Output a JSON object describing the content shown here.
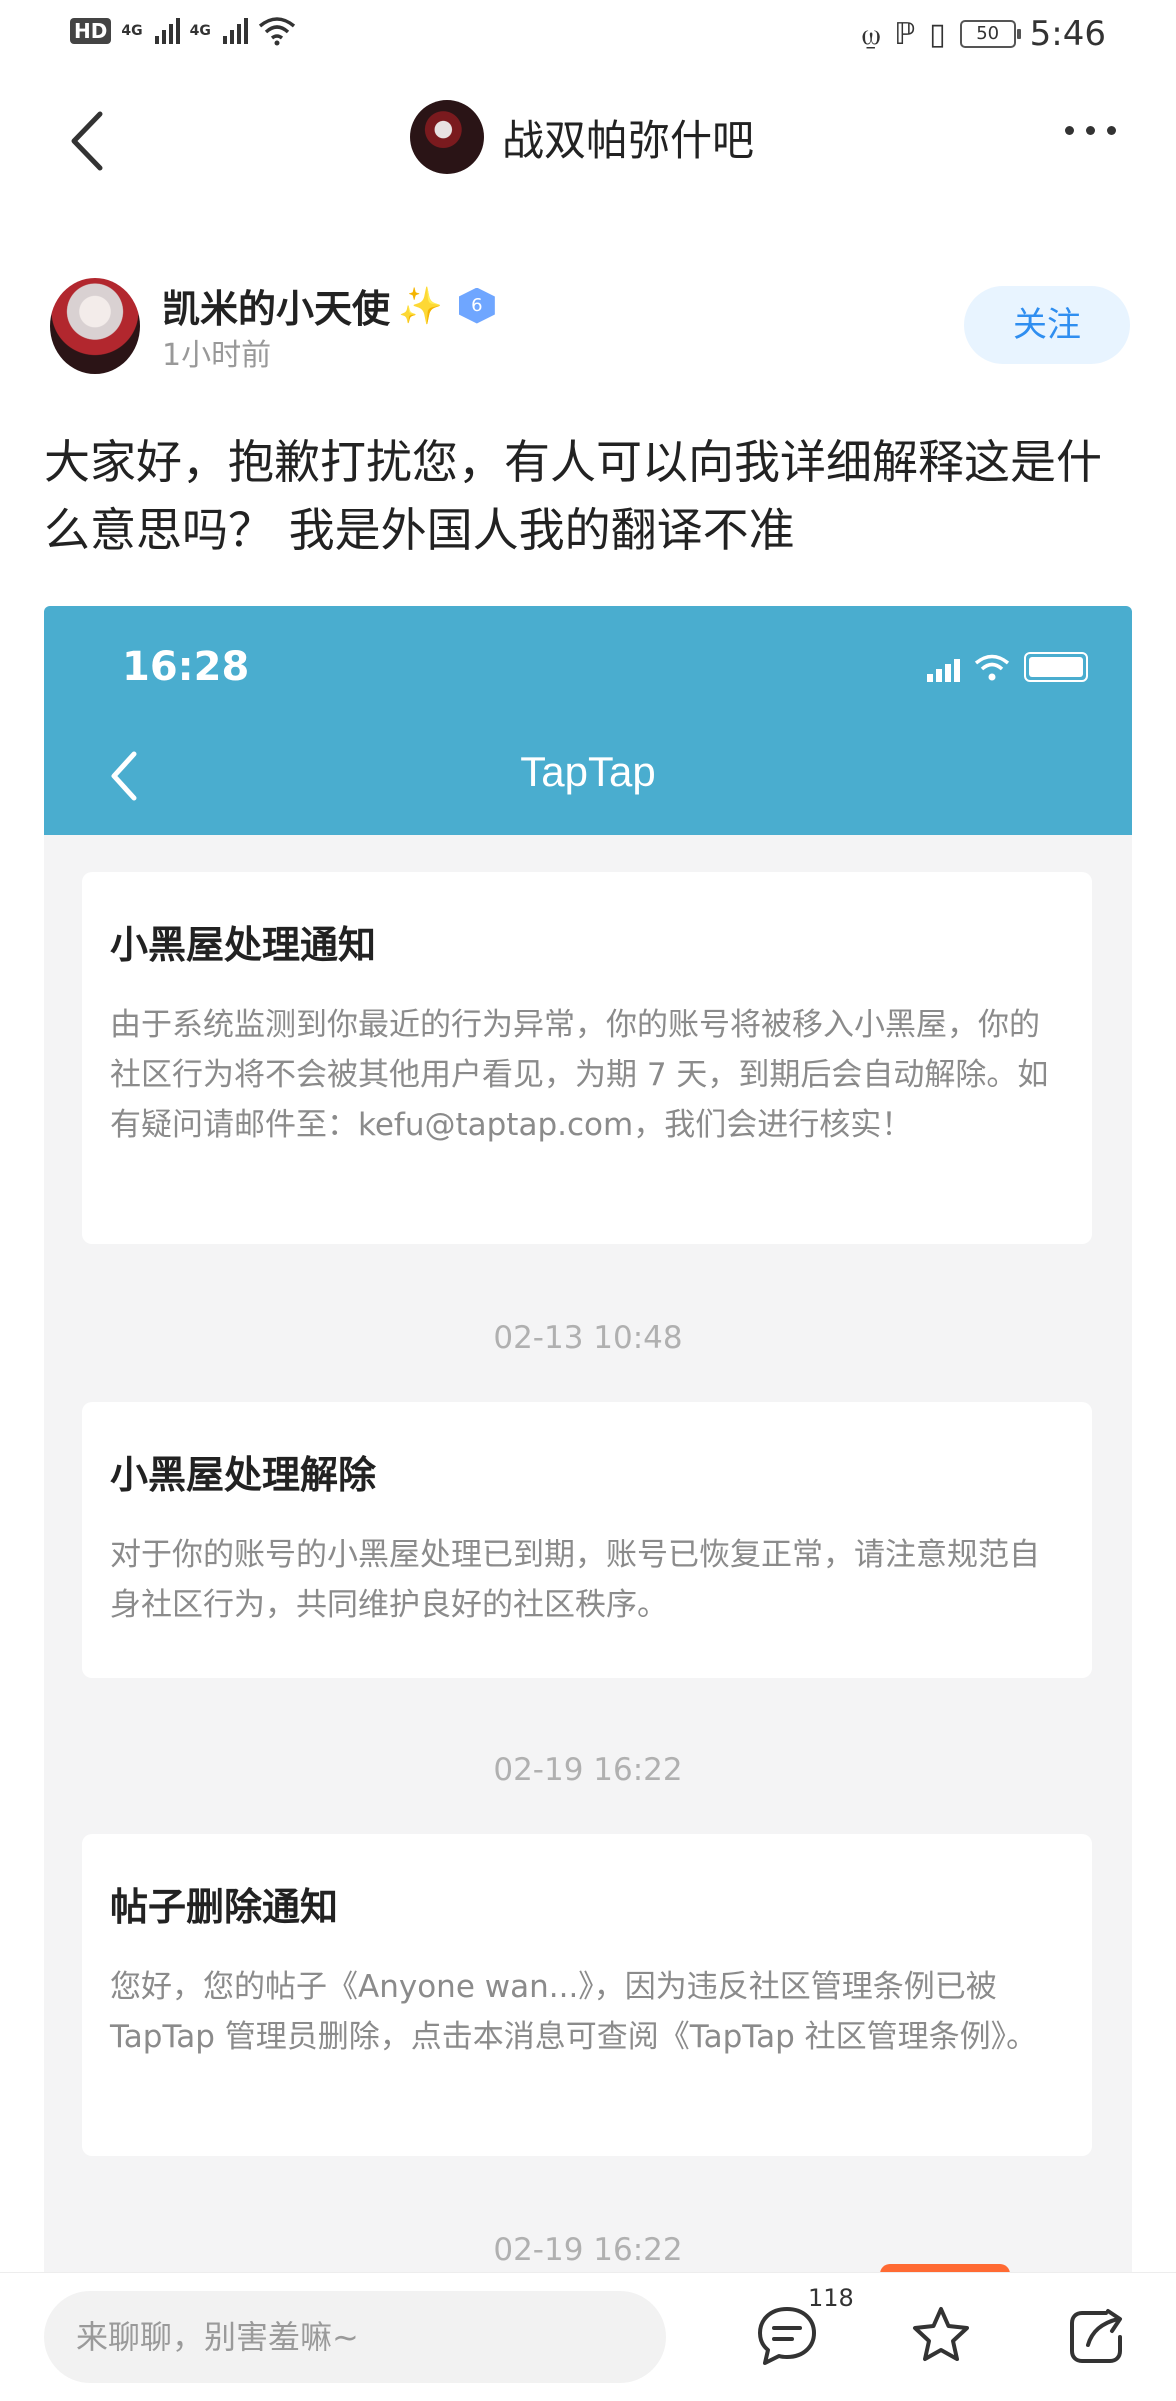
{
  "status_bar": {
    "hd_label": "HD",
    "network_1": "4G",
    "network_2": "4G",
    "battery": "50",
    "time": "5:46"
  },
  "header": {
    "forum_title": "战双帕弥什吧"
  },
  "post": {
    "author_name": "凯米的小天使",
    "level": "6",
    "time_ago": "1小时前",
    "follow_label": "关注",
    "text": "大家好，抱歉打扰您，有人可以向我详细解释这是什么意思吗？ 我是外国人我的翻译不准"
  },
  "screenshot": {
    "status_time": "16:28",
    "app_title": "TapTap",
    "notices": [
      {
        "title": "小黑屋处理通知",
        "body": "由于系统监测到你最近的行为异常，你的账号将被移入小黑屋，你的社区行为将不会被其他用户看见，为期 7 天，到期后会自动解除。如有疑问请邮件至：kefu@taptap.com，我们会进行核实！"
      },
      {
        "title": "小黑屋处理解除",
        "body": "对于你的账号的小黑屋处理已到期，账号已恢复正常，请注意规范自身社区行为，共同维护良好的社区秩序。"
      },
      {
        "title": "帖子删除通知",
        "body": "您好，您的帖子《Anyone wan...》，因为违反社区管理条例已被 TapTap 管理员删除，点击本消息可查阅《TapTap 社区管理条例》。"
      }
    ],
    "timestamps": [
      "02-13 10:48",
      "02-19 16:22",
      "02-19 16:22"
    ]
  },
  "bottom_bar": {
    "reply_placeholder": "来聊聊，别害羞嘛~",
    "comment_count": "118",
    "icons": [
      "comment-icon",
      "star-icon",
      "share-icon"
    ]
  },
  "colors": {
    "accent_blue": "#2f8ef0",
    "follow_bg": "#e8f4ff",
    "taptap_header": "#4aadcf",
    "notice_text": "#8b8b8b"
  }
}
